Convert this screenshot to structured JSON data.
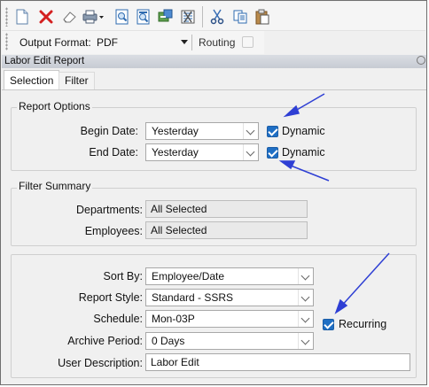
{
  "toolbar": {
    "icons": [
      "new-document-icon",
      "delete-icon",
      "eraser-icon",
      "print-icon",
      "preview-icon",
      "export-icon",
      "send-icon",
      "report-icon",
      "cut-icon",
      "copy-icon",
      "paste-icon"
    ]
  },
  "output": {
    "format_label": "Output Format:",
    "format_value": "PDF",
    "routing_label": "Routing",
    "routing_checked": false
  },
  "report": {
    "title": "Labor Edit Report"
  },
  "tabs": [
    {
      "label": "Selection",
      "active": true
    },
    {
      "label": "Filter",
      "active": false
    }
  ],
  "report_options": {
    "title": "Report Options",
    "begin_date_label": "Begin Date:",
    "begin_date_value": "Yesterday",
    "begin_dynamic_label": "Dynamic",
    "begin_dynamic_checked": true,
    "end_date_label": "End Date:",
    "end_date_value": "Yesterday",
    "end_dynamic_label": "Dynamic",
    "end_dynamic_checked": true
  },
  "filter_summary": {
    "title": "Filter Summary",
    "departments_label": "Departments:",
    "departments_value": "All Selected",
    "employees_label": "Employees:",
    "employees_value": "All Selected"
  },
  "settings": {
    "sort_by_label": "Sort By:",
    "sort_by_value": "Employee/Date",
    "report_style_label": "Report Style:",
    "report_style_value": "Standard - SSRS",
    "schedule_label": "Schedule:",
    "schedule_value": "Mon-03P",
    "recurring_label": "Recurring",
    "recurring_checked": true,
    "archive_period_label": "Archive Period:",
    "archive_period_value": "0 Days",
    "user_description_label": "User Description:",
    "user_description_value": "Labor Edit"
  },
  "colors": {
    "annotation_arrow": "#2e3fd4",
    "checkbox": "#1f6fc4"
  }
}
